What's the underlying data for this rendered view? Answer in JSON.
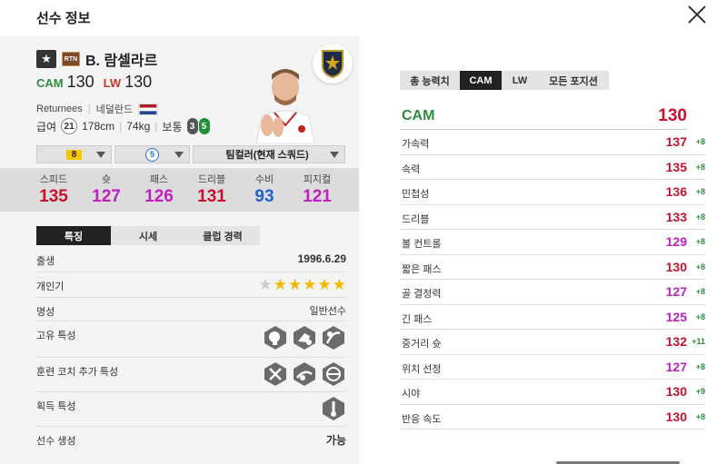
{
  "header": {
    "title": "선수 정보"
  },
  "player": {
    "season_badge": "RTN",
    "name": "B. 람셀라르",
    "positions": [
      {
        "pos": "CAM",
        "ovr": "130",
        "color": "#2e8b3e"
      },
      {
        "pos": "LW",
        "ovr": "130",
        "color": "#c0392b"
      }
    ],
    "season_name": "Returnees",
    "nationality": "네덜란드",
    "salary_label": "급여",
    "salary": "21",
    "height": "178cm",
    "weight": "74kg",
    "body_type": "보통",
    "weak_foot_left": "3",
    "weak_foot_right": "5"
  },
  "selectors": {
    "upgrade": "8",
    "adaptability": "5",
    "team_color": "팀컬러(현재 스쿼드)"
  },
  "summary_stats": [
    {
      "label": "스피드",
      "value": "135",
      "color": "#c8102e"
    },
    {
      "label": "슛",
      "value": "127",
      "color": "#c020c0"
    },
    {
      "label": "패스",
      "value": "126",
      "color": "#c020c0"
    },
    {
      "label": "드리블",
      "value": "131",
      "color": "#c8102e"
    },
    {
      "label": "수비",
      "value": "93",
      "color": "#2060d0"
    },
    {
      "label": "피지컬",
      "value": "121",
      "color": "#c020c0"
    }
  ],
  "info_tabs": [
    "특징",
    "시세",
    "클럽 경력"
  ],
  "info": {
    "birth_label": "출생",
    "birth": "1996.6.29",
    "popularity_label": "개인기",
    "popularity_stars": 5,
    "reputation_label": "명성",
    "reputation": "일반선수",
    "unique_traits_label": "고유 특성",
    "coach_traits_label": "훈련 코치 추가 특성",
    "acquired_traits_label": "획득 특성",
    "creation_label": "선수 생성",
    "creation": "가능"
  },
  "position_tabs": [
    "총 능력치",
    "CAM",
    "LW",
    "모든 포지션"
  ],
  "position_summary": {
    "pos": "CAM",
    "value": "130"
  },
  "attributes": [
    {
      "name": "가속력",
      "value": "137",
      "delta": "+8",
      "color": "#c8102e"
    },
    {
      "name": "속력",
      "value": "135",
      "delta": "+8",
      "color": "#c8102e"
    },
    {
      "name": "민첩성",
      "value": "136",
      "delta": "+8",
      "color": "#c8102e"
    },
    {
      "name": "드리블",
      "value": "133",
      "delta": "+8",
      "color": "#c8102e"
    },
    {
      "name": "볼 컨트롤",
      "value": "129",
      "delta": "+8",
      "color": "#c020c0"
    },
    {
      "name": "짧은 패스",
      "value": "130",
      "delta": "+8",
      "color": "#c8102e"
    },
    {
      "name": "골 결정력",
      "value": "127",
      "delta": "+8",
      "color": "#c020c0"
    },
    {
      "name": "긴 패스",
      "value": "125",
      "delta": "+8",
      "color": "#c020c0"
    },
    {
      "name": "중거리 슛",
      "value": "132",
      "delta": "+11",
      "color": "#c8102e"
    },
    {
      "name": "위치 선정",
      "value": "127",
      "delta": "+8",
      "color": "#c020c0"
    },
    {
      "name": "시야",
      "value": "130",
      "delta": "+9",
      "color": "#c8102e"
    },
    {
      "name": "반응 속도",
      "value": "130",
      "delta": "+8",
      "color": "#c8102e"
    }
  ]
}
